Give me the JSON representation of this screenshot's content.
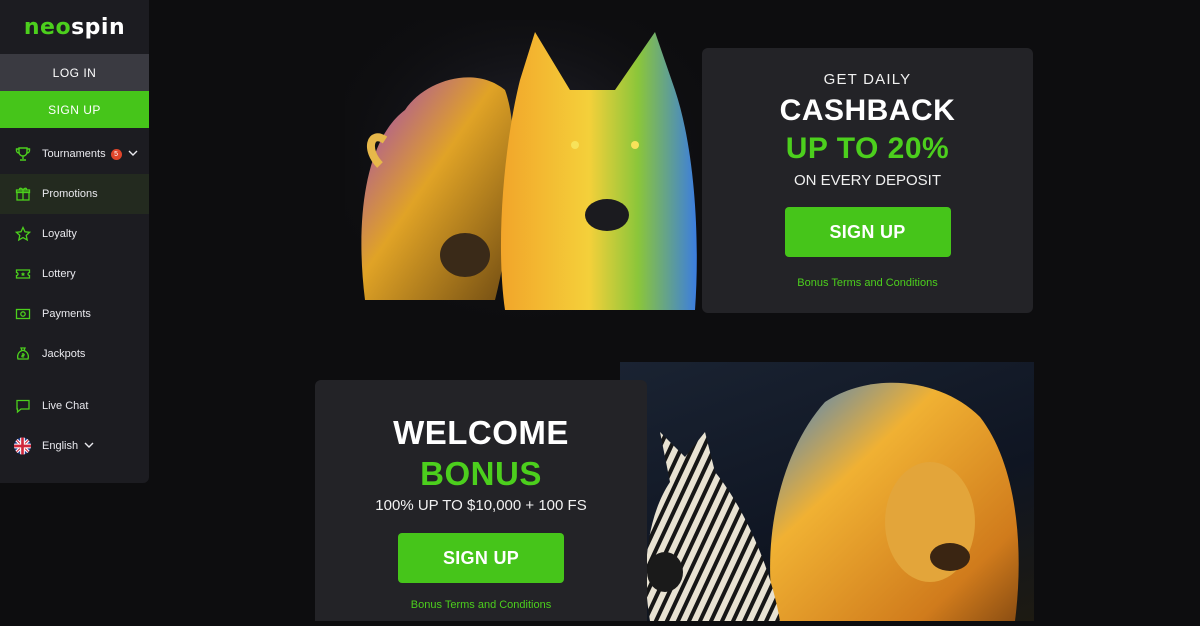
{
  "brand": {
    "logo_part1": "neo",
    "logo_part2": "spin",
    "accent_color": "#4ccf1d"
  },
  "sidebar": {
    "login_label": "LOG IN",
    "signup_label": "SIGN UP",
    "items": [
      {
        "label": "Tournaments",
        "icon": "trophy-icon",
        "badge": "5"
      },
      {
        "label": "Promotions",
        "icon": "gift-icon"
      },
      {
        "label": "Loyalty",
        "icon": "star-icon"
      },
      {
        "label": "Lottery",
        "icon": "ticket-icon"
      },
      {
        "label": "Payments",
        "icon": "cash-icon"
      },
      {
        "label": "Jackpots",
        "icon": "money-bag-icon"
      },
      {
        "label": "Live Chat",
        "icon": "chat-icon"
      },
      {
        "label": "English",
        "icon": "uk-flag-icon"
      }
    ]
  },
  "promo_cashback": {
    "line1": "GET DAILY",
    "line2": "CASHBACK",
    "line3": "UP TO 20%",
    "line4": "ON EVERY DEPOSIT",
    "button": "SIGN UP",
    "terms": "Bonus Terms and Conditions"
  },
  "promo_welcome": {
    "line1": "WELCOME",
    "line2": "BONUS",
    "line3": "100% UP TO $10,000 + 100 FS",
    "button": "SIGN UP",
    "terms": "Bonus Terms and Conditions"
  }
}
